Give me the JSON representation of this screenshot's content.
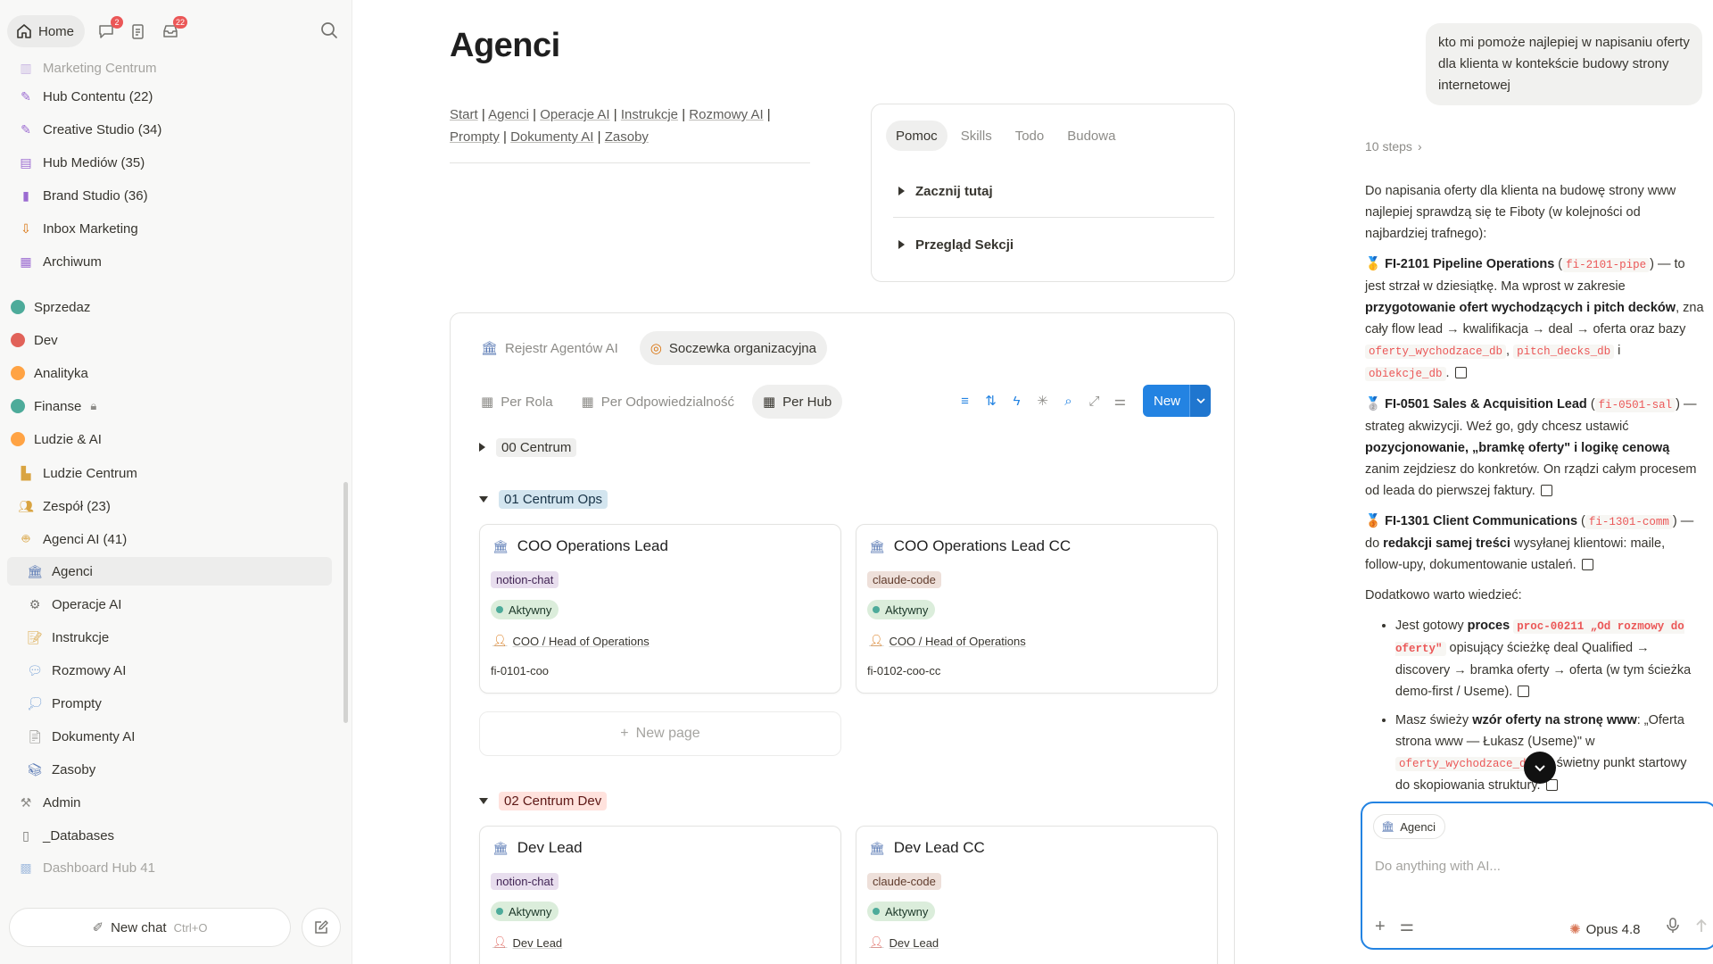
{
  "sidebar": {
    "home_label": "Home",
    "badges": {
      "chat": "2",
      "inbox": "22"
    },
    "items": [
      {
        "label": "Marketing Centrum",
        "icon": "chart-icon"
      },
      {
        "label": "Hub Contentu (22)",
        "icon": "pencil-icon"
      },
      {
        "label": "Creative Studio (34)",
        "icon": "pencil-icon"
      },
      {
        "label": "Hub Mediów (35)",
        "icon": "media-icon"
      },
      {
        "label": "Brand Studio (36)",
        "icon": "bookmark-icon"
      },
      {
        "label": "Inbox Marketing",
        "icon": "inbox-icon"
      },
      {
        "label": "Archiwum",
        "icon": "archive-icon"
      },
      {
        "label": "Sprzedaz",
        "icon": "dot-icon"
      },
      {
        "label": "Dev",
        "icon": "dot-icon"
      },
      {
        "label": "Analityka",
        "icon": "dot-icon"
      },
      {
        "label": "Finanse",
        "icon": "dot-icon"
      },
      {
        "label": "Ludzie & AI",
        "icon": "dot-icon"
      },
      {
        "label": "Ludzie Centrum",
        "icon": "chart-icon"
      },
      {
        "label": "Zespół (23)",
        "icon": "people-icon"
      },
      {
        "label": "Agenci AI (41)",
        "icon": "robot-icon"
      },
      {
        "label": "Agenci",
        "icon": "bank-icon"
      },
      {
        "label": "Operacje AI",
        "icon": "gear-icon"
      },
      {
        "label": "Instrukcje",
        "icon": "memo-icon"
      },
      {
        "label": "Rozmowy AI",
        "icon": "speech-icon"
      },
      {
        "label": "Prompty",
        "icon": "thought-icon"
      },
      {
        "label": "Dokumenty AI",
        "icon": "document-icon"
      },
      {
        "label": "Zasoby",
        "icon": "books-icon"
      },
      {
        "label": "Admin",
        "icon": "tools-icon"
      },
      {
        "label": "_Databases",
        "icon": "cabinet-icon"
      },
      {
        "label": "Dashboard Hub 41",
        "icon": "dashboard-icon"
      }
    ],
    "new_chat_label": "New chat",
    "new_chat_shortcut": "Ctrl+O"
  },
  "page": {
    "title": "Agenci",
    "breadcrumbs": [
      "Start",
      "Agenci",
      "Operacje AI",
      "Instrukcje",
      "Rozmowy AI",
      "Prompty",
      "Dokumenty AI",
      "Zasoby"
    ],
    "help_tabs": [
      "Pomoc",
      "Skills",
      "Todo",
      "Budowa"
    ],
    "toggles": [
      "Zacznij tutaj",
      "Przegląd Sekcji"
    ]
  },
  "database": {
    "source_tabs": [
      "Rejestr Agentów AI",
      "Soczewka organizacyjna"
    ],
    "views": [
      "Per Rola",
      "Per Odpowiedzialność",
      "Per Hub"
    ],
    "new_label": "New",
    "new_page_label": "New page",
    "groups": [
      {
        "label": "00 Centrum"
      },
      {
        "label": "01 Centrum Ops"
      },
      {
        "label": "02 Centrum Dev"
      }
    ],
    "cards": [
      {
        "title": "COO Operations Lead",
        "tag": "notion-chat",
        "status": "Aktywny",
        "role": "COO / Head of Operations",
        "id": "fi-0101-coo"
      },
      {
        "title": "COO Operations Lead CC",
        "tag": "claude-code",
        "status": "Aktywny",
        "role": "COO / Head of Operations",
        "id": "fi-0102-coo-cc"
      },
      {
        "title": "Dev Lead",
        "tag": "notion-chat",
        "status": "Aktywny",
        "role": "Dev Lead",
        "id": ""
      },
      {
        "title": "Dev Lead CC",
        "tag": "claude-code",
        "status": "Aktywny",
        "role": "Dev Lead",
        "id": ""
      }
    ]
  },
  "chat": {
    "user_message": "kto mi pomoże najlepiej w napisaniu oferty dla klienta w kontekście budowy strony internetowej",
    "steps_label": "10 steps",
    "intro": "Do napisania oferty dla klienta na budowę strony www najlepiej sprawdzą się te Fiboty (w kolejności od najbardziej trafnego):",
    "a1_name": "FI-2101 Pipeline Operations",
    "a1_code": "fi-2101-pipe",
    "a1_text1": "— to jest strzał w dziesiątkę. Ma wprost w zakresie",
    "a1_bold": "przygotowanie ofert wychodzących i pitch decków",
    "a1_text2": ", zna cały flow lead → kwalifikacja → deal → oferta oraz bazy",
    "a1_db1": "oferty_wychodzace_db",
    "a1_db2": "pitch_decks_db",
    "a1_and": "i",
    "a1_db3": "obiekcje_db",
    "a2_name": "FI-0501 Sales & Acquisition Lead",
    "a2_code": "fi-0501-sal",
    "a2_text1": "— strateg akwizycji. Weź go, gdy chcesz ustawić",
    "a2_bold": "pozycjonowanie, „bramkę oferty\" i logikę cenową",
    "a2_text2": "zanim zejdziesz do konkretów. On rządzi całym procesem od leada do pierwszej faktury.",
    "a3_name": "FI-1301 Client Communications",
    "a3_code": "fi-1301-comm",
    "a3_text1": "— do",
    "a3_bold": "redakcji samej treści",
    "a3_text2": "wysyłanej klientowi: maile, follow-upy, dokumentowanie ustaleń.",
    "extra_heading": "Dodatkowo warto wiedzieć:",
    "b1_text1": "Jest gotowy",
    "b1_bold": "proces",
    "b1_code": "proc-00211 „Od rozmowy do oferty\"",
    "b1_text2": "opisujący ścieżkę deal Qualified → discovery → bramka oferty → oferta (w tym ścieżka demo-first / Useme).",
    "b2_text1": "Masz świeży",
    "b2_bold": "wzór oferty na stronę www",
    "b2_text2": ": „Oferta strona www — Łukasz (Useme)\" w",
    "b2_code": "oferty_wychodzace_db",
    "b2_text3": "— świetny punkt startowy do skopiowania struktury.",
    "context_chip": "Agenci",
    "input_placeholder": "Do anything with AI...",
    "model_label": "Opus 4.8"
  },
  "colors": {
    "accent": "#2383e2",
    "sprzedaz_dot": "#4dab9a",
    "dev_dot": "#e16259",
    "analityka_dot": "#ffa344",
    "finanse_dot": "#4dab9a",
    "ludzie_dot": "#ffa344"
  }
}
